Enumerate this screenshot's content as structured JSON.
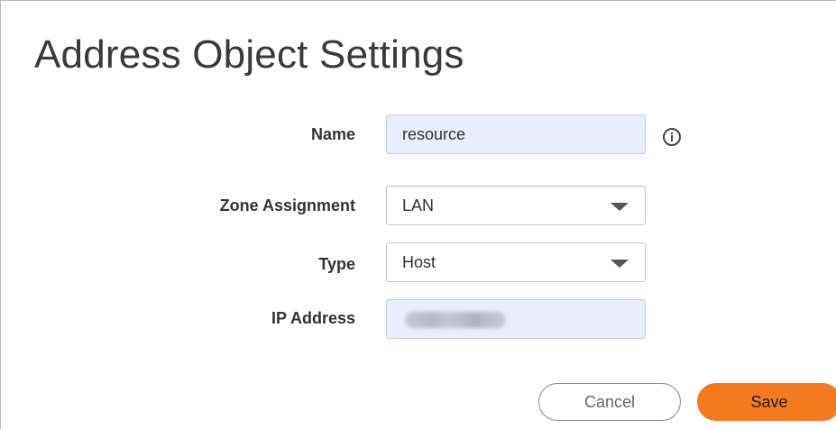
{
  "dialog": {
    "title": "Address Object Settings"
  },
  "form": {
    "name": {
      "label": "Name",
      "value": "resource"
    },
    "zone": {
      "label": "Zone Assignment",
      "selected": "LAN"
    },
    "type": {
      "label": "Type",
      "selected": "Host"
    },
    "ip": {
      "label": "IP Address",
      "value": ""
    }
  },
  "buttons": {
    "cancel_label": "Cancel",
    "save_label": "Save"
  },
  "colors": {
    "accent": "#f47a20",
    "input_bg": "#e8eefc"
  },
  "icons": {
    "info": "info-icon",
    "dropdown": "chevron-down-icon"
  }
}
